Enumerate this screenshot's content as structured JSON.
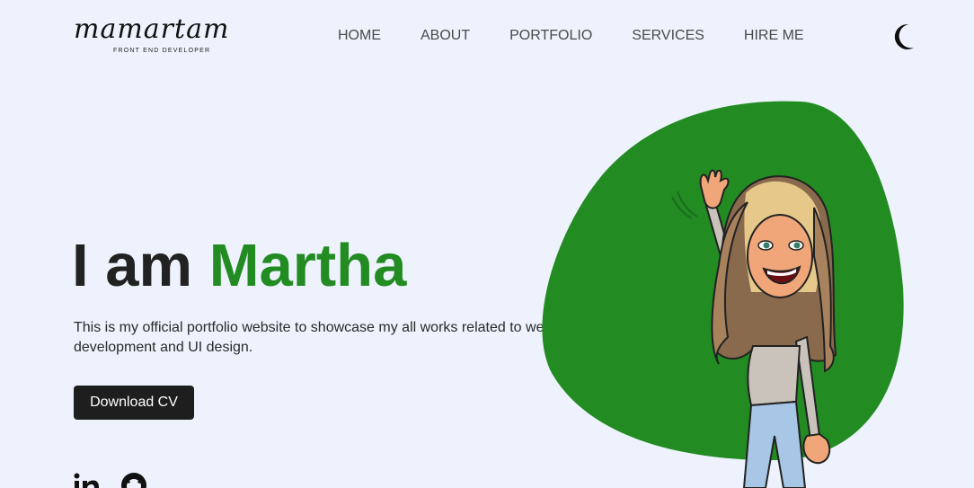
{
  "header": {
    "logo_text": "mamartam",
    "logo_tagline": "FRONT END DEVELOPER",
    "nav": [
      {
        "label": "HOME"
      },
      {
        "label": "ABOUT"
      },
      {
        "label": "PORTFOLIO"
      },
      {
        "label": "SERVICES"
      },
      {
        "label": "HIRE ME"
      }
    ],
    "theme_icon": "moon-icon"
  },
  "hero": {
    "title_prefix": "I am",
    "title_name": "Martha",
    "description": "This is my official portfolio website to showcase my all works related to web development and UI design.",
    "download_label": "Download CV",
    "social_icons": [
      "linkedin-icon",
      "github-icon"
    ]
  },
  "colors": {
    "accent": "#228b22",
    "background": "#edf2fc",
    "button": "#1e1e1e"
  }
}
